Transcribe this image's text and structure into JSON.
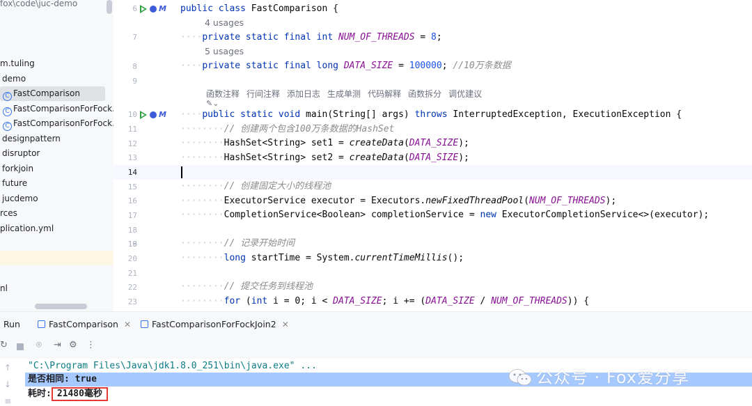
{
  "sidebar": {
    "path": "fox\\code\\juc-demo",
    "items": [
      {
        "label": "m.tuling",
        "kind": "package"
      },
      {
        "label": "demo",
        "kind": "package"
      },
      {
        "label": "FastComparison",
        "kind": "class",
        "selected": true
      },
      {
        "label": "FastComparisonForFock...",
        "kind": "class"
      },
      {
        "label": "FastComparisonForFock...",
        "kind": "class"
      },
      {
        "label": "designpattern",
        "kind": "package"
      },
      {
        "label": "disruptor",
        "kind": "package"
      },
      {
        "label": "forkjoin",
        "kind": "package"
      },
      {
        "label": "future",
        "kind": "package"
      },
      {
        "label": "jucdemo",
        "kind": "package"
      },
      {
        "label": "rces",
        "kind": "folder"
      },
      {
        "label": "plication.yml",
        "kind": "file"
      },
      {
        "label": "",
        "kind": "highlight"
      },
      {
        "label": "nl",
        "kind": "file"
      }
    ]
  },
  "editor": {
    "line_numbers": [
      "6",
      "7",
      "8",
      "9",
      "10",
      "11",
      "12",
      "13",
      "14",
      "15",
      "16",
      "17",
      "18",
      "19",
      "20",
      "21",
      "22",
      "23"
    ],
    "current_line": "14",
    "usages": [
      "4 usages",
      "5 usages"
    ],
    "ai_actions": [
      "函数注释",
      "行间注释",
      "添加日志",
      "生成单测",
      "代码解释",
      "函数拆分",
      "调优建议"
    ],
    "code": {
      "l6": {
        "kw": "public class",
        "name": "FastComparison",
        "rest": " {"
      },
      "l7": {
        "kw": "private static final int",
        "const": "NUM_OF_THREADS",
        "eq": " = ",
        "num": "8",
        "end": ";"
      },
      "l8": {
        "kw": "private static final long",
        "const": "DATA_SIZE",
        "eq": " = ",
        "num": "100000",
        "end": ";",
        "comment": "//10万条数据"
      },
      "l10": {
        "kw1": "public static void",
        "sig": " main(String[] args) ",
        "kw2": "throws",
        "rest": " InterruptedException, ExecutionException {"
      },
      "l11": {
        "comment": "// 创建两个包含100万条数据的HashSet"
      },
      "l12": {
        "type": "HashSet<String>",
        "var": " set1 = ",
        "call": "createData",
        "arg": "DATA_SIZE",
        "end": ");"
      },
      "l13": {
        "type": "HashSet<String>",
        "var": " set2 = ",
        "call": "createData",
        "arg": "DATA_SIZE",
        "end": ");"
      },
      "l15": {
        "comment": "// 创建固定大小的线程池"
      },
      "l16": {
        "type": "ExecutorService",
        "var": " executor = Executors.",
        "call": "newFixedThreadPool",
        "arg": "NUM_OF_THREADS",
        "end": ");"
      },
      "l17": {
        "type": "CompletionService<Boolean>",
        "var": " completionService = ",
        "kw": "new",
        "rest": " ExecutorCompletionService<>(executor);"
      },
      "l19": {
        "comment": "// 记录开始时间"
      },
      "l20": {
        "kw": "long",
        "var": " startTime = System.",
        "call": "currentTimeMillis",
        "end": "();"
      },
      "l22": {
        "comment": "// 提交任务到线程池"
      },
      "l23": {
        "kw": "for",
        "p1": " (",
        "kw2": "int",
        "p2": " i = 0; i < ",
        "c1": "DATA_SIZE",
        "p3": "; i += (",
        "c2": "DATA_SIZE",
        "p4": " / ",
        "c3": "NUM_OF_THREADS",
        "p5": ")) {"
      }
    }
  },
  "run_panel": {
    "title": "Run",
    "tabs": [
      {
        "label": "FastComparison"
      },
      {
        "label": "FastComparisonForFockJoin2"
      }
    ],
    "console": {
      "command": "\"C:\\Program Files\\Java\\jdk1.8.0_251\\bin\\java.exe\" ...",
      "line1_label": "是否相同: ",
      "line1_value": "true",
      "line2_label": "耗时:",
      "line2_value": "21480毫秒"
    }
  },
  "watermark": {
    "text": "公众号 · Fox爱分享"
  },
  "colors": {
    "keyword": "#0033b3",
    "constant": "#871094",
    "number": "#1750eb",
    "comment": "#8c8c8c",
    "selection": "#a6c9ff",
    "highlight_box": "#e53935"
  }
}
